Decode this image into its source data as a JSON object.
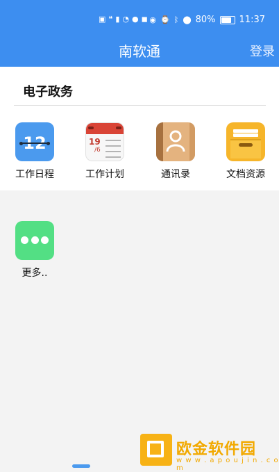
{
  "status_bar": {
    "left_icons": [
      "hd-icon",
      "quote-icon",
      "signal-icon",
      "wifi-icon",
      "chat-icon",
      "app-icon"
    ],
    "battery": "80%",
    "time": "11:37"
  },
  "header": {
    "title": "南软通",
    "login_label": "登录"
  },
  "section": {
    "title": "电子政务"
  },
  "apps": [
    {
      "label": "工作日程",
      "icon": "calendar-icon",
      "icon_text": "12"
    },
    {
      "label": "工作计划",
      "icon": "plan-calendar-icon",
      "icon_text": "19"
    },
    {
      "label": "通讯录",
      "icon": "address-book-icon"
    },
    {
      "label": "文档资源",
      "icon": "document-archive-icon"
    }
  ],
  "more": {
    "label": "更多.."
  },
  "watermark": {
    "brand": "欧金软件园",
    "url": "w w w . a p o u j i n . c o m"
  },
  "colors": {
    "header": "#3d8ef0",
    "more_icon": "#53df84",
    "watermark": "#f2a900"
  }
}
